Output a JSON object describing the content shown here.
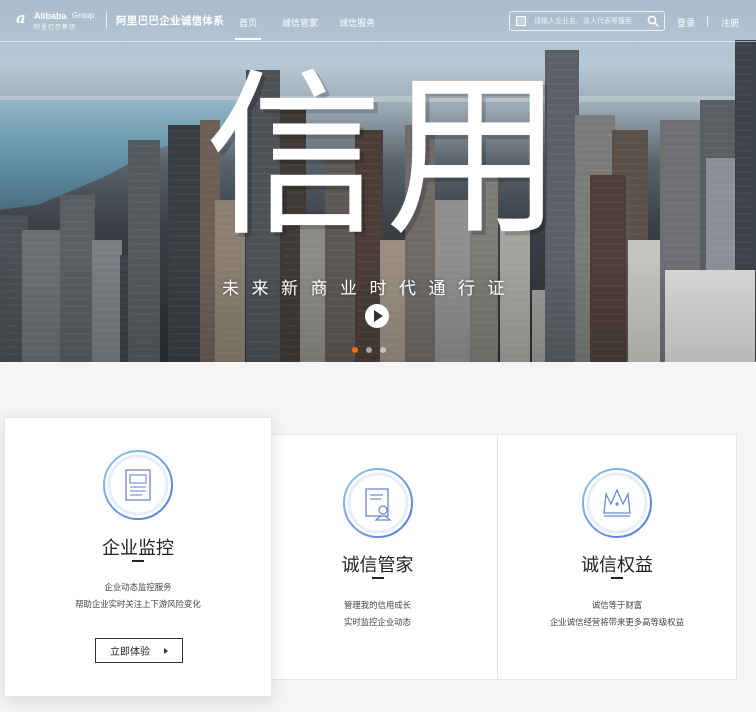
{
  "nav": {
    "logo_brand": "Alibaba",
    "logo_group": "Group",
    "logo_cn": "阿里巴巴集团",
    "site_title": "阿里巴巴企业诚信体系",
    "items": [
      {
        "label": "首页",
        "active": true
      },
      {
        "label": "诚信管家",
        "active": false
      },
      {
        "label": "诚信服务",
        "active": false
      }
    ],
    "search_placeholder": "请输入企业名、法人代表等搜索",
    "search_icon": "search-icon",
    "login": "登录",
    "register": "注册"
  },
  "hero": {
    "title": "信用",
    "subtitle": "未来新商业时代通行证",
    "play_icon": "play-icon",
    "slides": [
      {
        "active": true
      },
      {
        "active": false
      },
      {
        "active": false
      }
    ]
  },
  "cards": [
    {
      "title": "企业监控",
      "icon": "document-icon",
      "desc_lines": [
        "企业动态监控服务",
        "帮助企业实时关注上下游风险变化"
      ],
      "cta": "立即体验"
    },
    {
      "title": "诚信管家",
      "icon": "certificate-user-icon",
      "desc_lines": [
        "管理我的信用成长",
        "实时监控企业动态"
      ]
    },
    {
      "title": "诚信权益",
      "icon": "crown-icon",
      "desc_lines": [
        "诚信等于财富",
        "企业诚信经营将带来更多高等级权益"
      ]
    }
  ],
  "colors": {
    "accent": "#ff6a00",
    "icon_blue": "#5b8fd9",
    "text_dark": "#222222"
  }
}
